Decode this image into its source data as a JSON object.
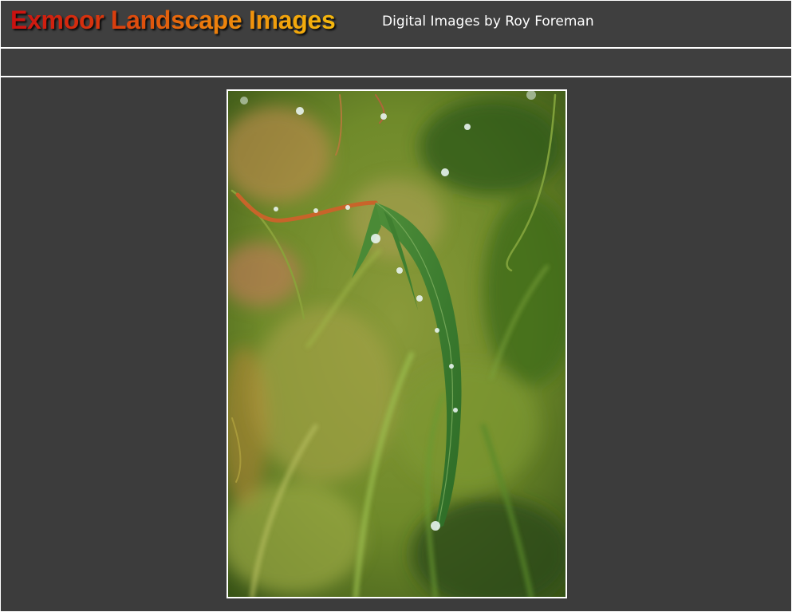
{
  "header": {
    "site_title": "Exmoor Landscape Images",
    "subtitle": "Digital Images by Roy Foreman"
  },
  "photo": {
    "subject": "leaf-photo",
    "accent_colors": [
      "#cc1010",
      "#f5b80e"
    ]
  },
  "colors": {
    "background": "#3c3c3c",
    "rules": "#ffffff",
    "title_gradient_start": "#cc1010",
    "title_gradient_end": "#f5b80e"
  }
}
